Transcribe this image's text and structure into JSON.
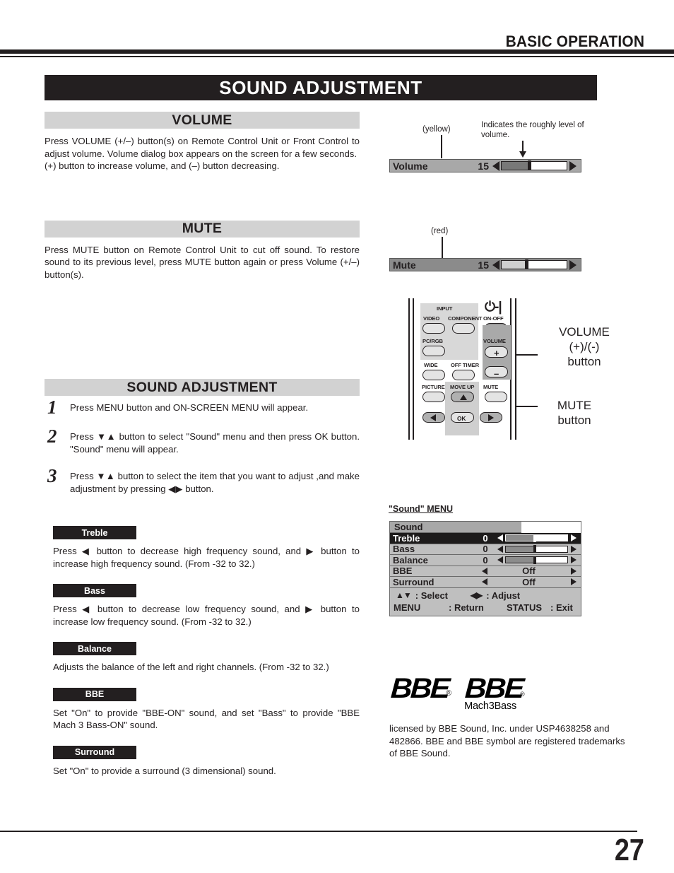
{
  "header": {
    "title": "BASIC OPERATION"
  },
  "banner": {
    "title": "SOUND ADJUSTMENT"
  },
  "volume_section": {
    "heading": "VOLUME",
    "body": "Press VOLUME (+/–) button(s) on Remote Control Unit or Front Control to adjust volume.  Volume dialog box appears on the screen for a few seconds.",
    "body2": "(+) button to increase volume, and (–) button decreasing."
  },
  "mute_section": {
    "heading": "MUTE",
    "body": "Press MUTE button on Remote Control Unit to cut off  sound.  To restore sound to its previous level, press MUTE button again or press Volume (+/–) button(s)."
  },
  "sound_section": {
    "heading": "SOUND ADJUSTMENT",
    "steps": [
      {
        "num": "1",
        "text": "Press MENU button and ON-SCREEN MENU will appear."
      },
      {
        "num": "2",
        "text": "Press  ▼▲   button to select \"Sound\" menu and then press OK button. \"Sound\" menu will appear."
      },
      {
        "num": "3",
        "text": "Press  ▼▲   button to select the item that you want to adjust ,and make adjustment  by pressing  ◀▶  button."
      }
    ],
    "items": [
      {
        "label": "Treble",
        "body": "Press  ◀ button to decrease high frequency sound, and ▶  button to increase high frequency sound.  (From -32 to 32.)"
      },
      {
        "label": "Bass",
        "body": "Press  ◀ button to decrease low frequency sound, and ▶  button to increase low frequency sound.  (From -32 to 32.)"
      },
      {
        "label": "Balance",
        "body": "Adjusts the balance of the left and right channels. (From -32 to 32.)"
      },
      {
        "label": "BBE",
        "body": "Set \"On\" to provide \"BBE-ON\" sound, and set \"Bass\" to provide \"BBE Mach 3 Bass-ON\" sound."
      },
      {
        "label": "Surround",
        "body": "Set \"On\" to provide a surround (3 dimensional) sound."
      }
    ]
  },
  "volume_dialog": {
    "color_note": "(yellow)",
    "indicator_note": "Indicates the roughly level\nof volume.",
    "name": "Volume",
    "value": "15"
  },
  "mute_dialog": {
    "color_note": "(red)",
    "name": "Mute",
    "value": "15"
  },
  "remote": {
    "group_input_label": "INPUT",
    "power_glyph": "⏻-|",
    "buttons": [
      "VIDEO",
      "COMPONENT",
      "ON-OFF",
      "PC/RGB",
      "VOLUME",
      "WIDE",
      "OFF TIMER",
      "PICTURE",
      "MOVE UP",
      "MUTE",
      "OK"
    ],
    "plus_label": "+",
    "minus_label": "–",
    "callout_volume": "VOLUME\n(+)/(-)\nbutton",
    "callout_mute": "MUTE\nbutton"
  },
  "sound_menu": {
    "caption": "\"Sound\" MENU",
    "title": "Sound",
    "rows": [
      {
        "name": "Treble",
        "value": "0",
        "type": "slider",
        "fill_pct": 47,
        "thumb_pct": 47,
        "selected": true
      },
      {
        "name": "Bass",
        "value": "0",
        "type": "slider",
        "fill_pct": 47,
        "thumb_pct": 47,
        "selected": false
      },
      {
        "name": "Balance",
        "value": "0",
        "type": "slider",
        "fill_pct": 47,
        "thumb_pct": 47,
        "selected": false
      },
      {
        "name": "BBE",
        "value": "Off",
        "type": "onoff",
        "selected": false
      },
      {
        "name": "Surround",
        "value": "Off",
        "type": "onoff",
        "selected": false
      }
    ],
    "foot": {
      "select_glyph": "▲▼",
      "select_label": ": Select",
      "adjust_glyph": "◀▶",
      "adjust_label": ":  Adjust",
      "menu_label": "MENU",
      "return_label": ": Return",
      "status_label": "STATUS",
      "exit_label": ":  Exit"
    }
  },
  "bbe": {
    "logo1": "BBE",
    "logo1_mark": "®",
    "logo2": "BBE",
    "logo2_mark": "®",
    "sub": "Mach3Bass",
    "note": "licensed by BBE Sound, Inc. under USP4638258 and 482866. BBE and BBE symbol are registered trademarks of BBE Sound."
  },
  "footer": {
    "page_number": "27"
  }
}
